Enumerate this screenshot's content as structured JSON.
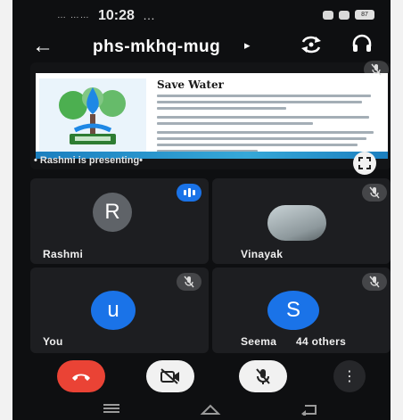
{
  "status_bar": {
    "left_indicators": "… ……",
    "time": "10:28",
    "dots": "…",
    "battery": "87"
  },
  "header": {
    "meeting_code": "phs-mkhq-mug",
    "caret": "▸"
  },
  "presentation": {
    "slide_title": "Save Water",
    "presenter_label": "• Rashmi is presenting•"
  },
  "participants": [
    {
      "name": "Rashmi",
      "initial": "R",
      "avatar_color": "#5f6368",
      "speaking": true
    },
    {
      "name": "Vinayak",
      "initial": "",
      "avatar_color": "#9aa4a8",
      "speaking": false
    },
    {
      "name": "You",
      "initial": "u",
      "avatar_color": "#1a73e8",
      "speaking": false
    },
    {
      "name": "Seema",
      "initial": "S",
      "avatar_color": "#1a73e8",
      "speaking": false,
      "others": "44 others"
    }
  ],
  "controls": {
    "more_label": "⋮"
  },
  "colors": {
    "end_call": "#ea4335",
    "accent": "#1a73e8"
  }
}
